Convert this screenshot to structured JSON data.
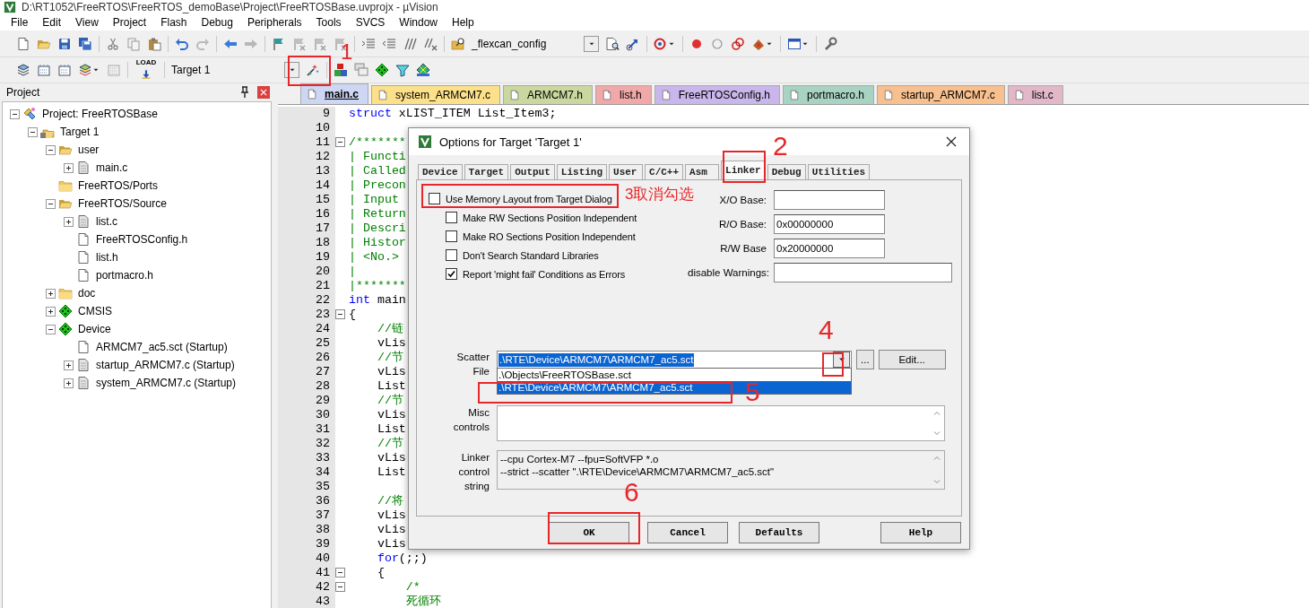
{
  "window": {
    "title": "D:\\RT1052\\FreeRTOS\\FreeRTOS_demoBase\\Project\\FreeRTOSBase.uvprojx - µVision"
  },
  "menu": [
    "File",
    "Edit",
    "View",
    "Project",
    "Flash",
    "Debug",
    "Peripherals",
    "Tools",
    "SVCS",
    "Window",
    "Help"
  ],
  "toolbar": {
    "config_combo": "_flexcan_config",
    "load_caption": "LOAD",
    "target_combo": "Target 1"
  },
  "project_panel": {
    "title": "Project",
    "tree": [
      {
        "label": "Project: FreeRTOSBase",
        "kind": "project",
        "expanded": true,
        "children": [
          {
            "label": "Target 1",
            "kind": "target",
            "expanded": true,
            "children": [
              {
                "label": "user",
                "kind": "folder",
                "expanded": true,
                "children": [
                  {
                    "label": "main.c",
                    "kind": "file",
                    "expanded": false
                  }
                ]
              },
              {
                "label": "FreeRTOS/Ports",
                "kind": "folder"
              },
              {
                "label": "FreeRTOS/Source",
                "kind": "folder",
                "expanded": true,
                "children": [
                  {
                    "label": "list.c",
                    "kind": "file",
                    "expanded": false
                  },
                  {
                    "label": "FreeRTOSConfig.h",
                    "kind": "file"
                  },
                  {
                    "label": "list.h",
                    "kind": "file"
                  },
                  {
                    "label": "portmacro.h",
                    "kind": "file"
                  }
                ]
              },
              {
                "label": "doc",
                "kind": "folder",
                "expanded": false
              },
              {
                "label": "CMSIS",
                "kind": "component",
                "expanded": false
              },
              {
                "label": "Device",
                "kind": "component",
                "expanded": true,
                "children": [
                  {
                    "label": "ARMCM7_ac5.sct (Startup)",
                    "kind": "file"
                  },
                  {
                    "label": "startup_ARMCM7.c (Startup)",
                    "kind": "file",
                    "expanded": false
                  },
                  {
                    "label": "system_ARMCM7.c (Startup)",
                    "kind": "file",
                    "expanded": false
                  }
                ]
              }
            ]
          }
        ]
      }
    ]
  },
  "editor_tabs": [
    {
      "label": "main.c",
      "selected": true,
      "color": "#cdd6f2"
    },
    {
      "label": "system_ARMCM7.c",
      "selected": false,
      "color": "#fde08a"
    },
    {
      "label": "ARMCM7.h",
      "selected": false,
      "color": "#cad79e"
    },
    {
      "label": "list.h",
      "selected": false,
      "color": "#f0a8a8"
    },
    {
      "label": "FreeRTOSConfig.h",
      "selected": false,
      "color": "#c9b6ea"
    },
    {
      "label": "portmacro.h",
      "selected": false,
      "color": "#a8d2c2"
    },
    {
      "label": "startup_ARMCM7.c",
      "selected": false,
      "color": "#f8c08e"
    },
    {
      "label": "list.c",
      "selected": false,
      "color": "#e2b8c9"
    }
  ],
  "code_lines": [
    {
      "number": "9",
      "segments": [
        {
          "text": "struct",
          "kind": "keyword"
        },
        {
          "text": " xLIST_ITEM List_Item3;",
          "kind": "plain"
        }
      ]
    },
    {
      "number": "10"
    },
    {
      "number": "11",
      "collapsible": true,
      "segments": [
        {
          "text": "/*******",
          "kind": "comment"
        }
      ]
    },
    {
      "number": "12",
      "segments": [
        {
          "text": "| Functi",
          "kind": "comment"
        }
      ]
    },
    {
      "number": "13",
      "segments": [
        {
          "text": "| Called",
          "kind": "comment"
        }
      ]
    },
    {
      "number": "14",
      "segments": [
        {
          "text": "| Precon",
          "kind": "comment"
        }
      ]
    },
    {
      "number": "15",
      "segments": [
        {
          "text": "| Input",
          "kind": "comment"
        }
      ]
    },
    {
      "number": "16",
      "segments": [
        {
          "text": "| Return",
          "kind": "comment"
        }
      ]
    },
    {
      "number": "17",
      "segments": [
        {
          "text": "| Descri",
          "kind": "comment"
        }
      ]
    },
    {
      "number": "18",
      "segments": [
        {
          "text": "| Histor",
          "kind": "comment"
        }
      ]
    },
    {
      "number": "19",
      "segments": [
        {
          "text": "| <No.>",
          "kind": "comment"
        }
      ]
    },
    {
      "number": "20",
      "segments": [
        {
          "text": "|",
          "kind": "comment"
        }
      ]
    },
    {
      "number": "21",
      "segments": [
        {
          "text": "|*******",
          "kind": "comment"
        }
      ]
    },
    {
      "number": "22",
      "segments": [
        {
          "text": "int",
          "kind": "keyword"
        },
        {
          "text": " main",
          "kind": "plain"
        }
      ]
    },
    {
      "number": "23",
      "collapsible": true,
      "segments": [
        {
          "text": "{",
          "kind": "plain"
        }
      ]
    },
    {
      "number": "24",
      "segments": [
        {
          "text": "    //链",
          "kind": "comment"
        }
      ]
    },
    {
      "number": "25",
      "segments": [
        {
          "text": "    vLis",
          "kind": "plain"
        }
      ]
    },
    {
      "number": "26",
      "segments": [
        {
          "text": "    //节",
          "kind": "comment"
        }
      ]
    },
    {
      "number": "27",
      "segments": [
        {
          "text": "    vLis",
          "kind": "plain"
        }
      ]
    },
    {
      "number": "28",
      "segments": [
        {
          "text": "    List",
          "kind": "plain"
        }
      ]
    },
    {
      "number": "29",
      "segments": [
        {
          "text": "    //节",
          "kind": "comment"
        }
      ]
    },
    {
      "number": "30",
      "segments": [
        {
          "text": "    vLis",
          "kind": "plain"
        }
      ]
    },
    {
      "number": "31",
      "segments": [
        {
          "text": "    List",
          "kind": "plain"
        }
      ]
    },
    {
      "number": "32",
      "segments": [
        {
          "text": "    //节",
          "kind": "comment"
        }
      ]
    },
    {
      "number": "33",
      "segments": [
        {
          "text": "    vLis",
          "kind": "plain"
        }
      ]
    },
    {
      "number": "34",
      "segments": [
        {
          "text": "    List",
          "kind": "plain"
        }
      ]
    },
    {
      "number": "35"
    },
    {
      "number": "36",
      "segments": [
        {
          "text": "    //将",
          "kind": "comment"
        }
      ]
    },
    {
      "number": "37",
      "segments": [
        {
          "text": "    vLis",
          "kind": "plain"
        }
      ]
    },
    {
      "number": "38",
      "segments": [
        {
          "text": "    vLis",
          "kind": "plain"
        }
      ]
    },
    {
      "number": "39",
      "segments": [
        {
          "text": "    vLis",
          "kind": "plain"
        }
      ]
    },
    {
      "number": "40",
      "segments": [
        {
          "text": "    for",
          "kind": "keyword"
        },
        {
          "text": "(;;)",
          "kind": "plain"
        }
      ]
    },
    {
      "number": "41",
      "collapsible": true,
      "segments": [
        {
          "text": "    {",
          "kind": "plain"
        }
      ]
    },
    {
      "number": "42",
      "collapsible": true,
      "segments": [
        {
          "text": "        /*",
          "kind": "comment"
        }
      ]
    },
    {
      "number": "43",
      "segments": [
        {
          "text": "        死循环",
          "kind": "comment"
        }
      ]
    }
  ],
  "dialog": {
    "title": "Options for Target 'Target 1'",
    "tabs": [
      {
        "label": "Device",
        "selected": false
      },
      {
        "label": "Target",
        "selected": false
      },
      {
        "label": "Output",
        "selected": false
      },
      {
        "label": "Listing",
        "selected": false
      },
      {
        "label": "User",
        "selected": false
      },
      {
        "label": "C/C++",
        "selected": false
      },
      {
        "label": "Asm",
        "selected": false
      },
      {
        "label": "Linker",
        "selected": true
      },
      {
        "label": "Debug",
        "selected": false
      },
      {
        "label": "Utilities",
        "selected": false
      }
    ],
    "options": [
      {
        "label": "Use Memory Layout from Target Dialog",
        "checked": false,
        "children": [
          {
            "label": "Make RW Sections Position Independent",
            "checked": false
          },
          {
            "label": "Make RO Sections Position Independent",
            "checked": false
          },
          {
            "label": "Don't Search Standard Libraries",
            "checked": false
          },
          {
            "label": "Report 'might fail' Conditions as Errors",
            "checked": true
          }
        ]
      }
    ],
    "fields": [
      {
        "label": "X/O Base:"
      },
      {
        "label": "R/O Base:",
        "value": "0x00000000"
      },
      {
        "label": "R/W Base",
        "value": "0x20000000"
      },
      {
        "label": "disable Warnings:",
        "kind": "wide"
      }
    ],
    "scatter": {
      "label": "Scatter File",
      "value": ".\\RTE\\Device\\ARMCM7\\ARMCM7_ac5.sct",
      "browse": "...",
      "edit": "Edit...",
      "options": [
        {
          "label": ".\\Objects\\FreeRTOSBase.sct",
          "selected": false
        },
        {
          "label": ".\\RTE\\Device\\ARMCM7\\ARMCM7_ac5.sct",
          "selected": true
        }
      ]
    },
    "misc": {
      "label": "Misc controls"
    },
    "linker": {
      "label": "Linker control string",
      "lines": [
        "--cpu Cortex-M7 --fpu=SoftVFP *.o",
        "--strict --scatter \".\\RTE\\Device\\ARMCM7\\ARMCM7_ac5.sct\""
      ]
    },
    "buttons": [
      "OK",
      "Cancel",
      "Defaults",
      "Help"
    ]
  },
  "annotations": [
    {
      "label": "1"
    },
    {
      "label": "2"
    },
    {
      "label": "3取消勾选"
    },
    {
      "label": "4"
    },
    {
      "label": "5"
    },
    {
      "label": "6"
    }
  ]
}
